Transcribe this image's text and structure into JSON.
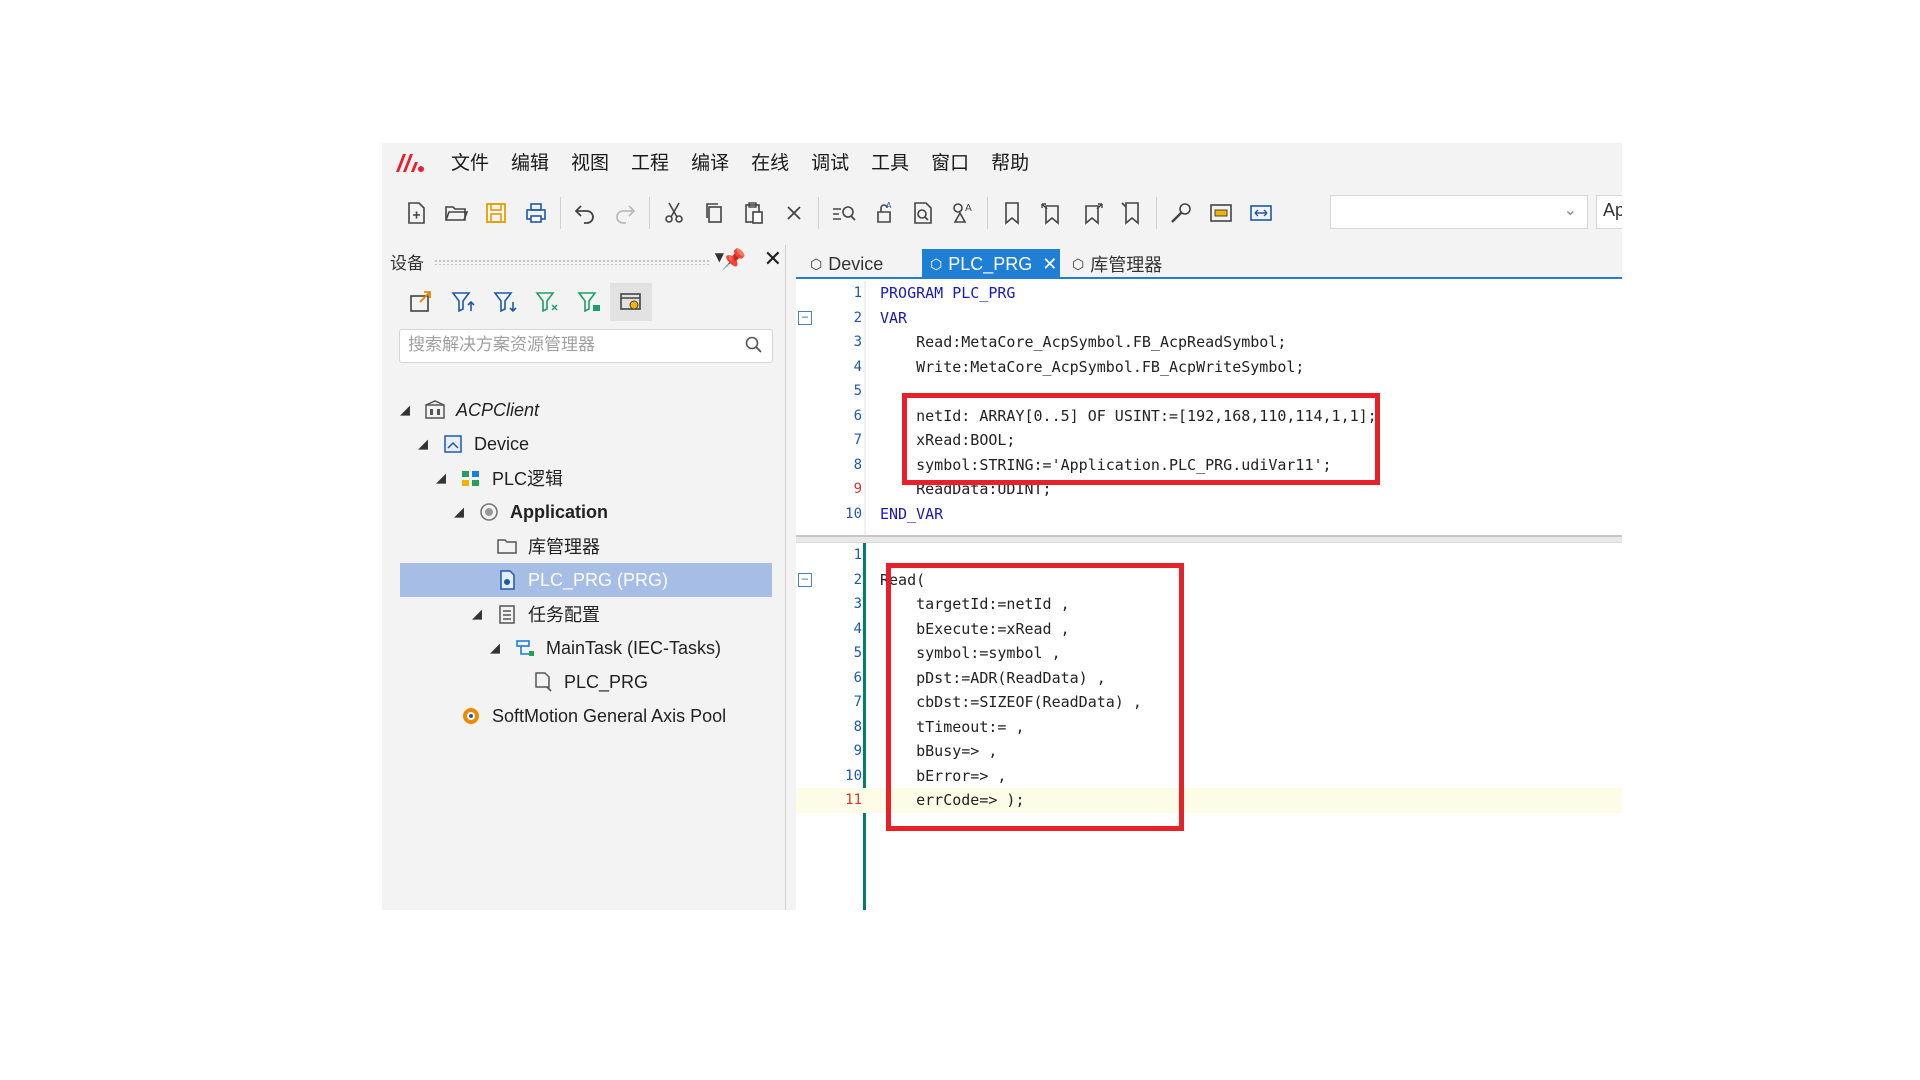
{
  "menu": [
    "文件",
    "编辑",
    "视图",
    "工程",
    "编译",
    "在线",
    "调试",
    "工具",
    "窗口",
    "帮助"
  ],
  "toolbar": {
    "icons": [
      "new-file-icon",
      "open-folder-icon",
      "save-icon",
      "print-icon",
      "undo-icon",
      "redo-icon",
      "cut-icon",
      "copy-icon",
      "paste-icon",
      "delete-icon",
      "find-icon",
      "replace-icon",
      "find-in-project-icon",
      "replace-all-icon",
      "bookmark-icon",
      "bookmark-prev-icon",
      "bookmark-next-icon",
      "bookmark-clear-icon",
      "tools-wrench-icon",
      "window-icon",
      "expand-icon"
    ],
    "combo_value": "",
    "combo2_text": "Ap"
  },
  "left_panel": {
    "title": "设备",
    "search_placeholder": "搜索解决方案资源管理器",
    "tree": [
      {
        "label": "ACPClient",
        "italic": true
      },
      {
        "label": "Device"
      },
      {
        "label": "PLC逻辑"
      },
      {
        "label": "Application",
        "bold": true
      },
      {
        "label": "库管理器"
      },
      {
        "label": "PLC_PRG (PRG)",
        "selected": true
      },
      {
        "label": "任务配置"
      },
      {
        "label": "MainTask (IEC-Tasks)"
      },
      {
        "label": "PLC_PRG"
      },
      {
        "label": "SoftMotion General Axis Pool"
      }
    ]
  },
  "tabs": [
    {
      "label": "Device"
    },
    {
      "label": "PLC_PRG",
      "active": true
    },
    {
      "label": "库管理器"
    }
  ],
  "declaration": {
    "lines": [
      {
        "n": "1",
        "text": "PROGRAM PLC_PRG"
      },
      {
        "n": "2",
        "text": "VAR"
      },
      {
        "n": "3",
        "text": "    Read:MetaCore_AcpSymbol.FB_AcpReadSymbol;"
      },
      {
        "n": "4",
        "text": "    Write:MetaCore_AcpSymbol.FB_AcpWriteSymbol;"
      },
      {
        "n": "5",
        "text": ""
      },
      {
        "n": "6",
        "text": "    netId: ARRAY[0..5] OF USINT:=[192,168,110,114,1,1];"
      },
      {
        "n": "7",
        "text": "    xRead:BOOL;"
      },
      {
        "n": "8",
        "text": "    symbol:STRING:='Application.PLC_PRG.udiVar11';"
      },
      {
        "n": "9",
        "text": "    ReadData:UDINT;"
      },
      {
        "n": "10",
        "text": "END_VAR"
      }
    ]
  },
  "implementation": {
    "lines": [
      {
        "n": "1",
        "text": ""
      },
      {
        "n": "2",
        "text": "Read("
      },
      {
        "n": "3",
        "text": "    targetId:=netId ,"
      },
      {
        "n": "4",
        "text": "    bExecute:=xRead ,"
      },
      {
        "n": "5",
        "text": "    symbol:=symbol ,"
      },
      {
        "n": "6",
        "text": "    pDst:=ADR(ReadData) ,"
      },
      {
        "n": "7",
        "text": "    cbDst:=SIZEOF(ReadData) ,"
      },
      {
        "n": "8",
        "text": "    tTimeout:= ,"
      },
      {
        "n": "9",
        "text": "    bBusy=> ,"
      },
      {
        "n": "10",
        "text": "    bError=> ,"
      },
      {
        "n": "11",
        "text": "    errCode=> );"
      }
    ]
  },
  "colors": {
    "accent": "#1e7fd4",
    "selection": "#a6bde6",
    "highlight_box": "#e8202a",
    "keyword": "#1a1ab8",
    "gutter_bar": "#00806b"
  }
}
